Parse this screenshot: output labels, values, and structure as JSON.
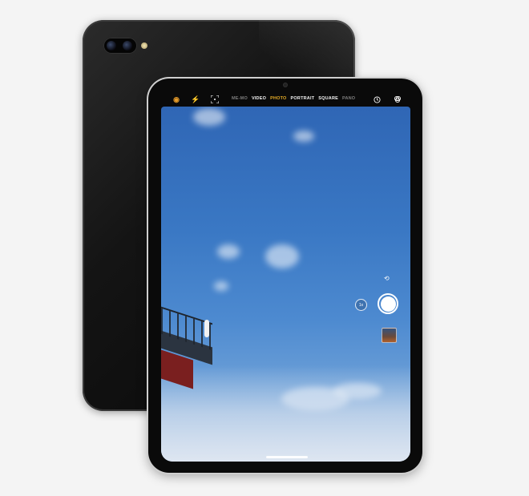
{
  "camera_app": {
    "modes": [
      {
        "label": "ME-MO",
        "state": "faded"
      },
      {
        "label": "VIDEO",
        "state": "normal"
      },
      {
        "label": "PHOTO",
        "state": "active"
      },
      {
        "label": "PORTRAIT",
        "state": "normal"
      },
      {
        "label": "SQUARE",
        "state": "normal"
      },
      {
        "label": "PANO",
        "state": "faded"
      }
    ],
    "zoom_label": "1x",
    "icons": {
      "live": "live-photo-icon",
      "flash": "flash-icon",
      "grid": "grid-icon",
      "timer": "timer-icon",
      "filters": "filters-icon",
      "switch_camera": "switch-camera-icon"
    },
    "colors": {
      "active_mode": "#f0b429",
      "live_icon": "#e39a2a"
    }
  }
}
